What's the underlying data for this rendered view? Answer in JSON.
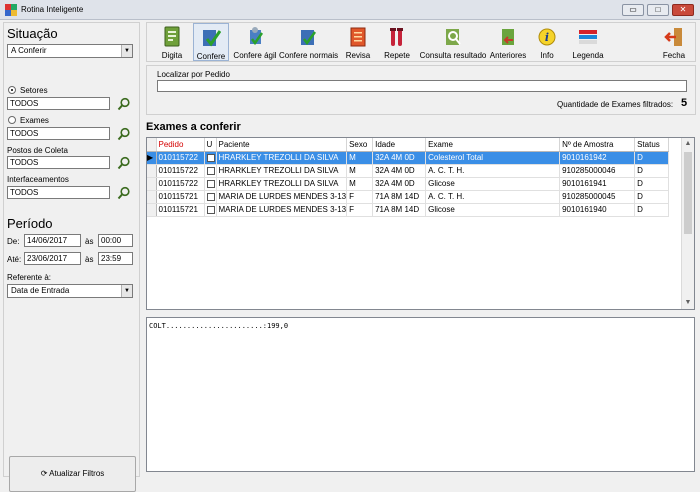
{
  "window": {
    "title": "Rotina Inteligente",
    "minimize": "▭",
    "maximize": "□",
    "close": "✕"
  },
  "left": {
    "situacao_title": "Situação",
    "situacao_value": "A Conferir",
    "setores_label": "Setores",
    "setores_value": "TODOS",
    "exames_label": "Exames",
    "exames_value": "TODOS",
    "postos_label": "Postos de Coleta",
    "postos_value": "TODOS",
    "interface_label": "Interfaceamentos",
    "interface_value": "TODOS",
    "periodo_title": "Período",
    "de_label": "De:",
    "de_date": "14/06/2017",
    "de_as": "às",
    "de_time": "00:00",
    "ate_label": "Até:",
    "ate_date": "23/06/2017",
    "ate_as": "às",
    "ate_time": "23:59",
    "referente_label": "Referente à:",
    "referente_value": "Data de Entrada",
    "refresh_label": "Atualizar Filtros"
  },
  "toolbar": {
    "digita": "Digita",
    "confere": "Confere",
    "confere_agil": "Confere ágil",
    "confere_normais": "Confere normais",
    "revisa": "Revisa",
    "repete": "Repete",
    "consulta": "Consulta resultado",
    "anteriores": "Anteriores",
    "info": "Info",
    "legenda": "Legenda",
    "fecha": "Fecha"
  },
  "locate": {
    "label": "Localizar por Pedido",
    "input_value": "",
    "count_label": "Quantidade de Exames filtrados:",
    "count_value": "5"
  },
  "grid": {
    "title": "Exames a conferir",
    "columns": [
      "Pedido",
      "U",
      "Paciente",
      "Sexo",
      "Idade",
      "Exame",
      "Nº de Amostra",
      "Status"
    ],
    "rows": [
      [
        "010115722",
        "",
        "HRARKLEY TREZOLLI DA SILVA",
        "M",
        "32A 4M 0D",
        "Colesterol Total",
        "9010161942",
        "D"
      ],
      [
        "010115722",
        "",
        "HRARKLEY TREZOLLI DA SILVA",
        "M",
        "32A 4M 0D",
        "A. C. T. H.",
        "910285000046",
        "D"
      ],
      [
        "010115722",
        "",
        "HRARKLEY TREZOLLI DA SILVA",
        "M",
        "32A 4M 0D",
        "Glicose",
        "9010161941",
        "D"
      ],
      [
        "010115721",
        "",
        "MARIA DE LURDES MENDES 3-13",
        "F",
        "71A 8M 14D",
        "A. C. T. H.",
        "910285000045",
        "D"
      ],
      [
        "010115721",
        "",
        "MARIA DE LURDES MENDES 3-13",
        "F",
        "71A 8M 14D",
        "Glicose",
        "9010161940",
        "D"
      ]
    ],
    "selected_row": 0
  },
  "memo": {
    "text": "COLT.......................:199,0"
  },
  "colors": {
    "selection": "#3a8ee6",
    "pedido_header": "#d40000"
  }
}
